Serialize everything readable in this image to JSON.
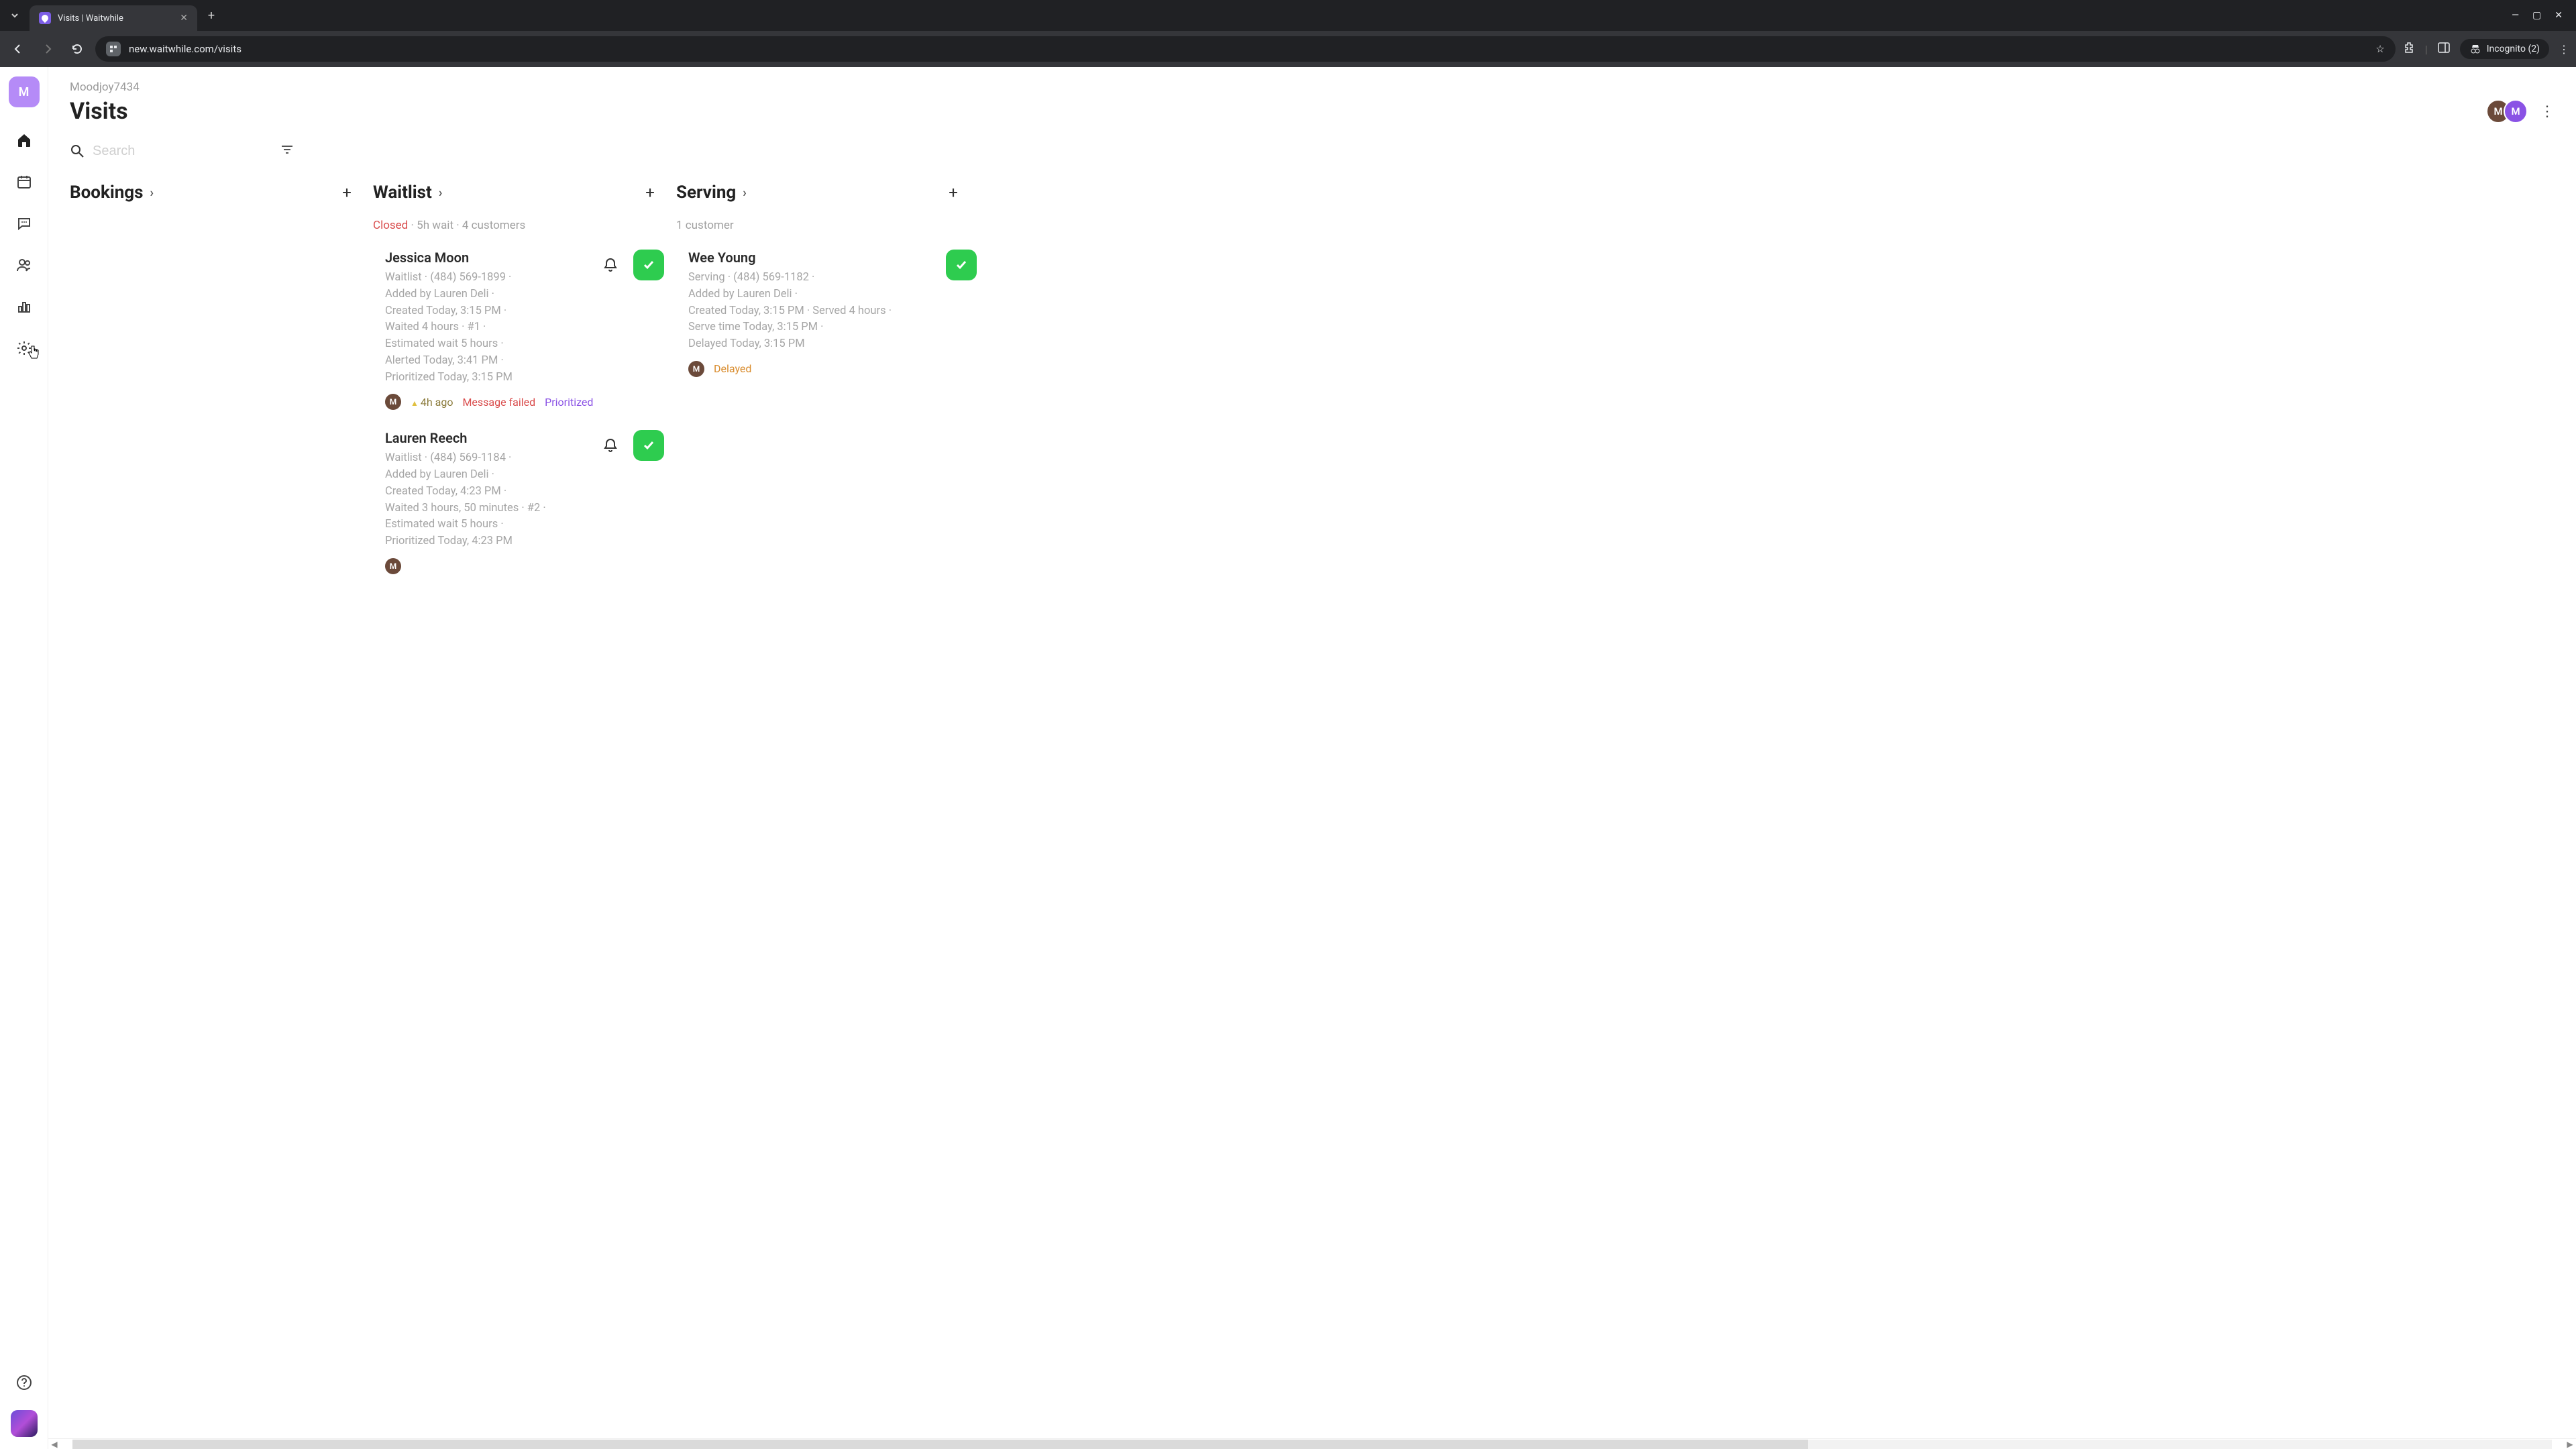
{
  "chrome": {
    "tab_title": "Visits | Waitwhile",
    "url": "new.waitwhile.com/visits",
    "incognito_label": "Incognito (2)"
  },
  "sidebar": {
    "org_letter": "M"
  },
  "header": {
    "breadcrumb": "Moodjoy7434",
    "title": "Visits",
    "avatar1": "M",
    "avatar2": "M"
  },
  "search": {
    "placeholder": "Search"
  },
  "columns": {
    "bookings": {
      "title": "Bookings"
    },
    "waitlist": {
      "title": "Waitlist",
      "status_closed": "Closed",
      "status_rest": " · 5h wait · 4 customers",
      "cards": [
        {
          "name": "Jessica Moon",
          "line1": "Waitlist · (484) 569-1899 ·",
          "line2": "Added by Lauren Deli ·",
          "line3": "Created Today, 3:15 PM ·",
          "line4": "Waited 4 hours · #1 ·",
          "line5": "Estimated wait 5 hours ·",
          "line6": "Alerted Today, 3:41 PM ·",
          "line7": "Prioritized Today, 3:15 PM",
          "badge_avatar": "M",
          "badge_warn": "4h ago",
          "badge_fail": "Message failed",
          "badge_prio": "Prioritized"
        },
        {
          "name": "Lauren Reech",
          "line1": "Waitlist · (484) 569-1184 ·",
          "line2": "Added by Lauren Deli ·",
          "line3": "Created Today, 4:23 PM ·",
          "line4": "Waited 3 hours, 50 minutes · #2 ·",
          "line5": "Estimated wait 5 hours ·",
          "line6": "Prioritized Today, 4:23 PM",
          "line7": "",
          "badge_avatar": "M",
          "badge_warn": "",
          "badge_fail": "",
          "badge_prio": ""
        }
      ]
    },
    "serving": {
      "title": "Serving",
      "status": "1 customer",
      "cards": [
        {
          "name": "Wee Young",
          "line1": "Serving · (484) 569-1182 ·",
          "line2": "Added by Lauren Deli ·",
          "line3": "Created Today, 3:15 PM · Served 4 hours ·",
          "line4": "Serve time Today, 3:15 PM ·",
          "line5": "Delayed Today, 3:15 PM",
          "badge_avatar": "M",
          "badge_delay": "Delayed"
        }
      ]
    }
  }
}
